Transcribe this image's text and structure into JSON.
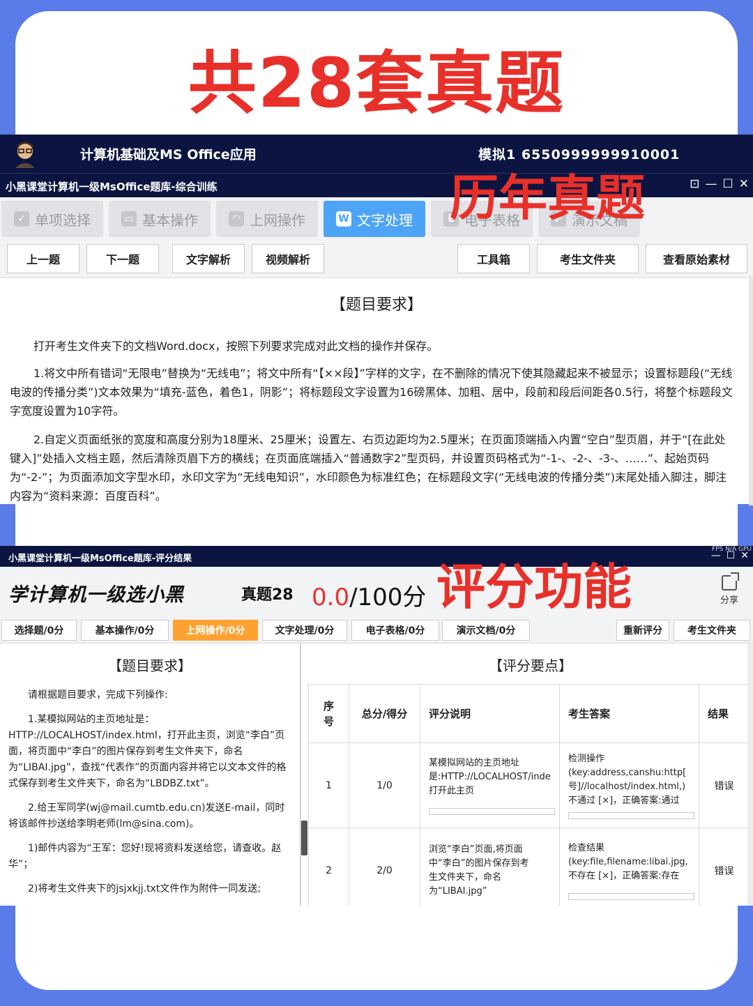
{
  "headline": "共28套真题",
  "window1": {
    "app_bar": {
      "subject": "计算机基础及MS Office应用",
      "exam_info": "模拟1   6550999999910001"
    },
    "title": "小黑课堂计算机一级MsOffice题库-综合训练",
    "window_controls": [
      "⊡",
      "—",
      "☐",
      "✕"
    ],
    "tabs": [
      {
        "label": "单项选择",
        "icon": "✓"
      },
      {
        "label": "基本操作",
        "icon": "▭"
      },
      {
        "label": "上网操作",
        "icon": "◠"
      },
      {
        "label": "文字处理",
        "icon": "W"
      },
      {
        "label": "电子表格",
        "icon": "E"
      },
      {
        "label": "演示文稿",
        "icon": "P"
      }
    ],
    "active_tab": "文字处理",
    "toolbar": {
      "prev": "上一题",
      "next": "下一题",
      "text_analysis": "文字解析",
      "video_analysis": "视频解析",
      "toolbox": "工具箱",
      "student_folder": "考生文件夹",
      "view_original": "查看原始素材"
    },
    "requirements_title": "【题目要求】",
    "intro": "打开考生文件夹下的文档Word.docx，按照下列要求完成对此文档的操作并保存。",
    "paragraphs": [
      "1.将文中所有错词“无限电”替换为“无线电”；将文中所有“【××段】”字样的文字，在不删除的情况下使其隐藏起来不被显示；设置标题段(“无线电波的传播分类”)文本效果为“填充-蓝色，着色1，阴影”；将标题段文字设置为16磅黑体、加粗、居中，段前和段后间距各0.5行，将整个标题段文字宽度设置为10字符。",
      "2.自定义页面纸张的宽度和高度分别为18厘米、25厘米；设置左、右页边距均为2.5厘米；在页面顶端插入内置“空白”型页眉，并于“[在此处键入]”处插入文档主题，然后清除页眉下方的横线；在页面底端插入“普通数字2”型页码，并设置页码格式为“-1-、-2-、-3-、……”、起始页码为“-2-”；为页面添加文字型水印，水印文字为“无线电知识”，水印颜色为标准红色；在标题段文字(“无线电波的传播分类”)末尾处插入脚注，脚注内容为“资料来源：百度百科”。"
    ],
    "overlay": "历年真题"
  },
  "window2": {
    "title": "小黑课堂计算机一级MsOffice题库-评分结果",
    "fps_text": "FPS N/A GPU",
    "window_controls": [
      "—",
      "☐",
      "✕"
    ],
    "brand": "学计算机一级选小黑",
    "paper": "真题28",
    "score_got": "0.0",
    "score_total": "/100分",
    "overlay": "评分功能",
    "share_label": "分享",
    "score_tabs": [
      "选择题/0分",
      "基本操作/0分",
      "上网操作/0分",
      "文字处理/0分",
      "电子表格/0分",
      "演示文档/0分"
    ],
    "active_score_tab": "上网操作/0分",
    "rescore": "重新评分",
    "student_folder": "考生文件夹",
    "left": {
      "title": "【题目要求】",
      "paragraphs": [
        "请根据题目要求，完成下列操作:",
        "1.某模拟网站的主页地址是：",
        "HTTP://LOCALHOST/index.html，打开此主页，浏览“李白”页面，将页面中“李白”的图片保存到考生文件夹下，命名为“LIBAI.jpg”，查找“代表作”的页面内容并将它以文本文件的格式保存到考生文件夹下，命名为“LBDBZ.txt”。",
        "2.给王军同学(wj@mail.cumtb.edu.cn)发送E-mail，同时将该邮件抄送给李明老师(lm@sina.com)。",
        "1)邮件内容为“王军：您好!现将资料发送给您，请查收。赵华”；",
        "2)将考生文件夹下的jsjxkjj.txt文件作为附件一同发送;"
      ]
    },
    "right": {
      "title": "【评分要点】",
      "headers": [
        "序号",
        "总分/得分",
        "评分说明",
        "考生答案",
        "结果"
      ],
      "rows": [
        {
          "no": "1",
          "score": "1/0",
          "desc": [
            "某模拟网站的主页地址",
            "是:HTTP://LOCALHOST/inde",
            "打开此主页"
          ],
          "answer": [
            "检测操作",
            "(key:address,canshu:http[",
            "号]//localhost/index.html,)",
            "不通过 [×]，正确答案:通过"
          ],
          "result": "错误"
        },
        {
          "no": "2",
          "score": "2/0",
          "desc": [
            "浏览“李白”页面,将页面",
            "中“李白”的图片保存到考",
            "生文件夹下，命名",
            "为“LIBAI.jpg”"
          ],
          "answer": [
            "检查结果",
            "(key:file,filename:libai.jpg,",
            "不存在 [×]，正确答案:存在"
          ],
          "result": "错误"
        }
      ]
    }
  },
  "colors": {
    "accent_red": "#e8302a",
    "navy": "#0c1541",
    "tab_active_blue": "#4da4f6",
    "tab_active_orange": "#ffa232",
    "background_blue": "#5a7ce8"
  }
}
